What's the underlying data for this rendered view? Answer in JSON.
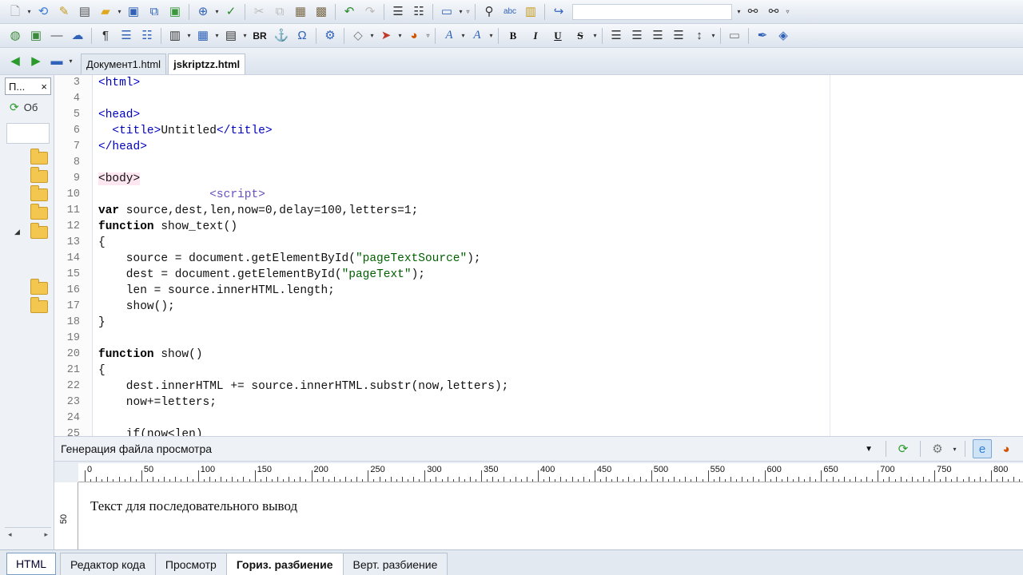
{
  "toolbar1": {
    "icons": [
      "new-file-icon",
      "open-url-icon",
      "edit-icon",
      "print-icon",
      "open-folder-icon",
      "save-icon",
      "save-all-icon",
      "save-ftp-icon",
      "zoom-icon",
      "spellcheck-icon",
      "cut-icon",
      "copy-icon",
      "paste-icon",
      "paste-special-icon",
      "undo-icon",
      "redo-icon",
      "indent-icon",
      "outdent-icon",
      "layout-icon",
      "find-icon",
      "replace-icon",
      "find-in-files-icon",
      "hyperlink-icon",
      "binoculars-next-icon",
      "binoculars-prev-icon"
    ],
    "search_value": ""
  },
  "toolbar2": {
    "icons": [
      "web-icon",
      "image-icon",
      "hr-icon",
      "comment-icon",
      "paragraph-icon",
      "unordered-list-icon",
      "ordered-list-icon",
      "columns-icon",
      "table-icon",
      "form-icon"
    ],
    "br_label": "BR",
    "anchor_glyph": "⚓",
    "omega_glyph": "Ω",
    "bold_label": "B",
    "italic_label": "I",
    "underline_label": "U",
    "strike_label": "S"
  },
  "doc_tabs": [
    {
      "label": "Документ1.html",
      "active": false
    },
    {
      "label": "jskriptzz.html",
      "active": true
    }
  ],
  "left_panel": {
    "tab_label": "П...",
    "close_glyph": "×",
    "refresh_label": "Об",
    "expand_glyph": "◢",
    "scroll_left": "◂",
    "scroll_right": "▸"
  },
  "code_lines": [
    {
      "n": "3",
      "parts": [
        [
          "tag",
          "<html>"
        ]
      ]
    },
    {
      "n": "4",
      "parts": []
    },
    {
      "n": "5",
      "parts": [
        [
          "tag",
          "<head>"
        ]
      ]
    },
    {
      "n": "6",
      "parts": [
        [
          "pl",
          "  "
        ],
        [
          "tag",
          "<title>"
        ],
        [
          "pl",
          "Untitled"
        ],
        [
          "tag",
          "</title>"
        ]
      ]
    },
    {
      "n": "7",
      "parts": [
        [
          "tag",
          "</head>"
        ]
      ]
    },
    {
      "n": "8",
      "parts": []
    },
    {
      "n": "9",
      "parts": [
        [
          "bodyhl",
          "<body>"
        ]
      ]
    },
    {
      "n": "10",
      "parts": [
        [
          "pl",
          "                "
        ],
        [
          "tagfaint",
          "<script>"
        ]
      ]
    },
    {
      "n": "11",
      "parts": [
        [
          "kw",
          "var"
        ],
        [
          "pl",
          " source,dest,len,now=0,delay=100,letters=1;"
        ]
      ]
    },
    {
      "n": "12",
      "parts": [
        [
          "kw",
          "function"
        ],
        [
          "pl",
          " show_text()"
        ]
      ]
    },
    {
      "n": "13",
      "parts": [
        [
          "pl",
          "{"
        ]
      ]
    },
    {
      "n": "14",
      "parts": [
        [
          "pl",
          "    source = document.getElementById("
        ],
        [
          "str",
          "\"pageTextSource\""
        ],
        [
          "pl",
          ");"
        ]
      ]
    },
    {
      "n": "15",
      "parts": [
        [
          "pl",
          "    dest = document.getElementById("
        ],
        [
          "str",
          "\"pageText\""
        ],
        [
          "pl",
          ");"
        ]
      ]
    },
    {
      "n": "16",
      "parts": [
        [
          "pl",
          "    len = source.innerHTML.length;"
        ]
      ]
    },
    {
      "n": "17",
      "parts": [
        [
          "pl",
          "    show();"
        ]
      ]
    },
    {
      "n": "18",
      "parts": [
        [
          "pl",
          "}"
        ]
      ]
    },
    {
      "n": "19",
      "parts": []
    },
    {
      "n": "20",
      "parts": [
        [
          "kw",
          "function"
        ],
        [
          "pl",
          " show()"
        ]
      ]
    },
    {
      "n": "21",
      "parts": [
        [
          "pl",
          "{"
        ]
      ]
    },
    {
      "n": "22",
      "parts": [
        [
          "pl",
          "    dest.innerHTML += source.innerHTML.substr(now,letters);"
        ]
      ]
    },
    {
      "n": "23",
      "parts": [
        [
          "pl",
          "    now+=letters;"
        ]
      ]
    },
    {
      "n": "24",
      "parts": []
    },
    {
      "n": "25",
      "parts": [
        [
          "pl",
          "    if(now<len)"
        ]
      ]
    }
  ],
  "preview_bar": {
    "label": "Генерация файла просмотра"
  },
  "ruler": {
    "labels": [
      "0",
      "50",
      "100",
      "150",
      "200",
      "250",
      "300",
      "350",
      "400",
      "450",
      "500",
      "550",
      "600",
      "650",
      "700",
      "750",
      "800"
    ],
    "vertical_label": "50"
  },
  "preview": {
    "text": "Текст для последовательного вывод"
  },
  "bottom_tabs": {
    "html_label": "HTML",
    "tabs": [
      {
        "label": "Редактор кода",
        "active": false
      },
      {
        "label": "Просмотр",
        "active": false
      },
      {
        "label": "Гориз. разбиение",
        "active": true
      },
      {
        "label": "Верт. разбиение",
        "active": false
      }
    ]
  }
}
